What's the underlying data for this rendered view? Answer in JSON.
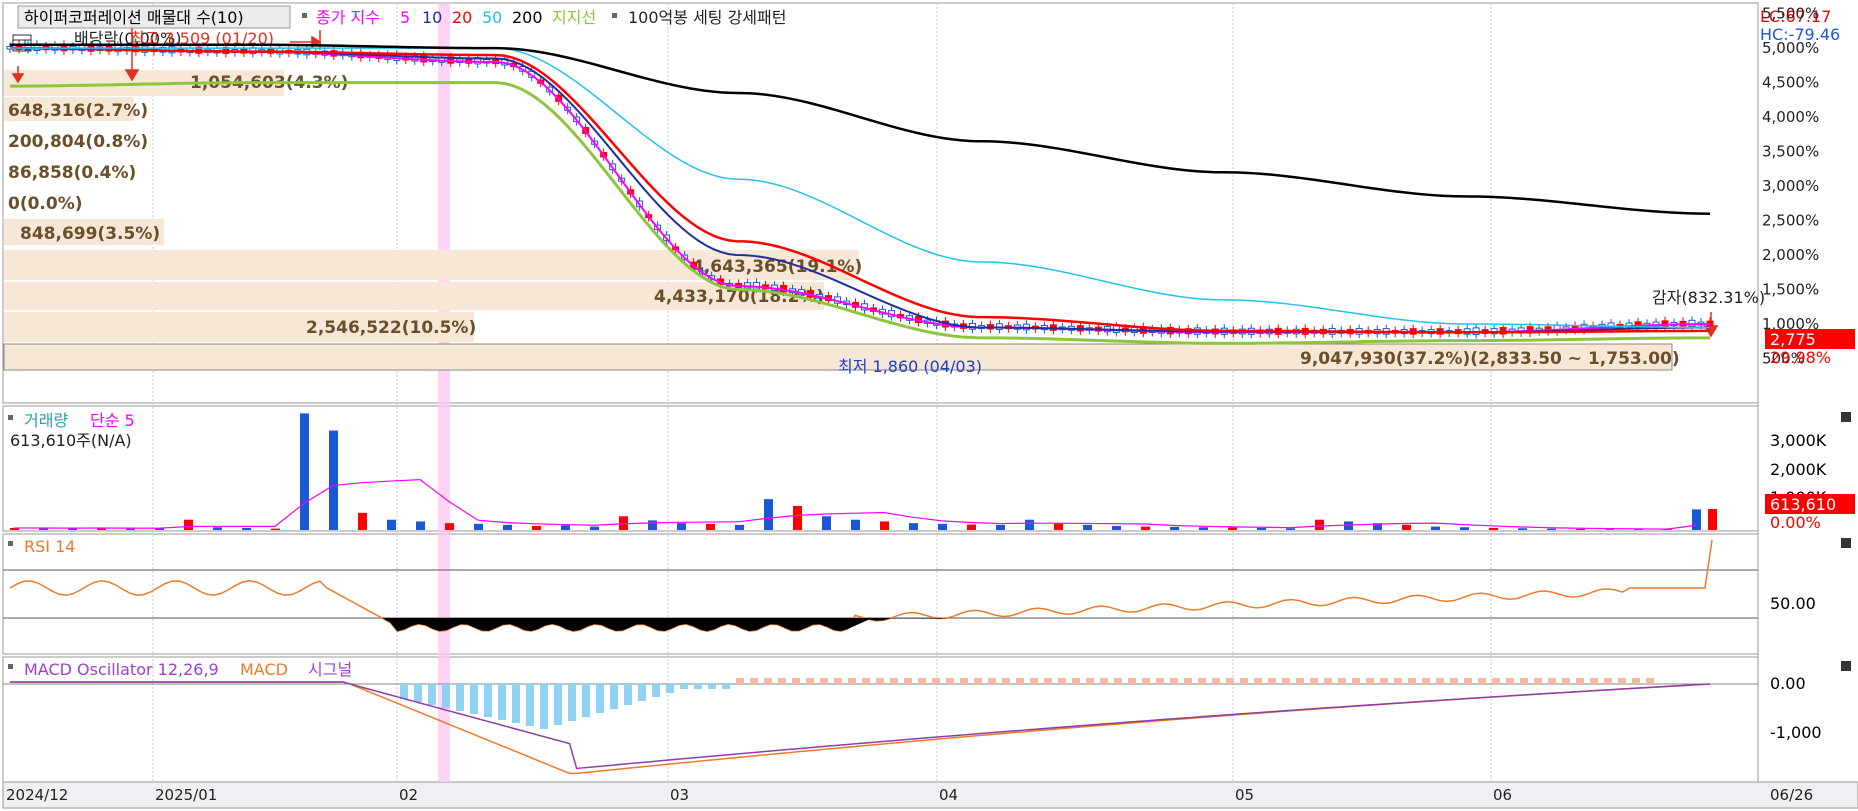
{
  "title_bar": {
    "name": "하이퍼코퍼레이션 매물대 수(10)",
    "indicator": "종가 지수",
    "ma_periods": [
      "5",
      "10",
      "20",
      "50",
      "200"
    ],
    "support_label": "지지선",
    "pattern_label": "100억봉 세팅 강세패턴",
    "lc": "LC:67.17",
    "hc": "HC:-79.46"
  },
  "colors": {
    "ma5": "#ff00ff",
    "ma10": "#1e2f9e",
    "ma20": "#ff0000",
    "ma50": "#22c3e8",
    "ma200": "#000000",
    "support": "#8cc63e",
    "up": "#ff0000",
    "down": "#1a58d6",
    "band": "#f6e7d6",
    "highlight": "#ff9ef2",
    "rsi": "#f07a2a",
    "macd": "#f07a2a",
    "signal": "#8b3fa8",
    "osc_pos": "#f3b9a2",
    "osc_neg": "#8fd2f4"
  },
  "annotations": {
    "dividend": "배당락(0.00%)",
    "high": "최고 3,509 (01/20)",
    "low": "최저 1,860 (04/03)",
    "capital_reduction": "감자(832.31%)"
  },
  "price_axis": [
    "5,500%",
    "5,000%",
    "4,500%",
    "4,000%",
    "3,500%",
    "3,000%",
    "2,500%",
    "2,000%",
    "1,500%",
    "1,000%",
    "500%"
  ],
  "price_tags": {
    "current": "2,775",
    "pct": "29.98%"
  },
  "volume_profile": [
    {
      "label": "1,054,603(4.3%)"
    },
    {
      "label": "648,316(2.7%)"
    },
    {
      "label": "200,804(0.8%)"
    },
    {
      "label": "86,858(0.4%)"
    },
    {
      "label": "0(0.0%)"
    },
    {
      "label": "848,699(3.5%)"
    },
    {
      "label": "4,643,365(19.1%)"
    },
    {
      "label": "4,433,170(18.2%)"
    },
    {
      "label": "2,546,522(10.5%)"
    },
    {
      "label": "9,047,930(37.2%)(2,833.50 ~ 1,753.00)"
    }
  ],
  "volume_panel": {
    "title": "거래량",
    "ma_label": "단순 5",
    "current": "613,610주(N/A)",
    "axis": [
      "3,000K",
      "2,000K",
      "1,000K"
    ],
    "tag_value": "613,610",
    "tag_pct": "0.00%"
  },
  "rsi_panel": {
    "title": "RSI 14",
    "axis": [
      "50.00"
    ]
  },
  "macd_panel": {
    "title": "MACD Oscillator 12,26,9",
    "macd_label": "MACD",
    "signal_label": "시그널",
    "axis": [
      "0.00",
      "-1,000"
    ]
  },
  "x_axis": [
    "2024/12",
    "2025/01",
    "02",
    "03",
    "04",
    "05",
    "06"
  ],
  "x_axis_right": "06/26",
  "chart_data": {
    "type": "line",
    "title": "하이퍼코퍼레이션 매물대 수(10)",
    "y_unit": "%",
    "ylim": [
      0,
      5800
    ],
    "x": [
      "2024/12",
      "2025/01",
      "02",
      "03",
      "04",
      "05",
      "06",
      "06/26"
    ],
    "series": [
      {
        "name": "5",
        "values": [
          5000,
          4950,
          4800,
          1550,
          950,
          880,
          880,
          1000
        ]
      },
      {
        "name": "10",
        "values": [
          5000,
          4950,
          4850,
          2000,
          950,
          890,
          880,
          950
        ]
      },
      {
        "name": "20",
        "values": [
          5000,
          4950,
          4900,
          2200,
          1100,
          900,
          880,
          900
        ]
      },
      {
        "name": "50",
        "values": [
          5000,
          5000,
          5000,
          3100,
          1900,
          1350,
          1000,
          950
        ]
      },
      {
        "name": "200",
        "values": [
          5050,
          5050,
          5000,
          4350,
          3650,
          3200,
          2850,
          2600
        ]
      },
      {
        "name": "지지선",
        "values": [
          4450,
          4500,
          4500,
          1500,
          800,
          720,
          760,
          800
        ]
      }
    ],
    "rsi": {
      "ylim": [
        0,
        100
      ],
      "levels": [
        30,
        50,
        70
      ],
      "start": 55,
      "end": 95
    },
    "volume": {
      "unit": "주",
      "ylim": [
        0,
        3500
      ],
      "max_bar": 3400,
      "last": 613.61
    }
  }
}
